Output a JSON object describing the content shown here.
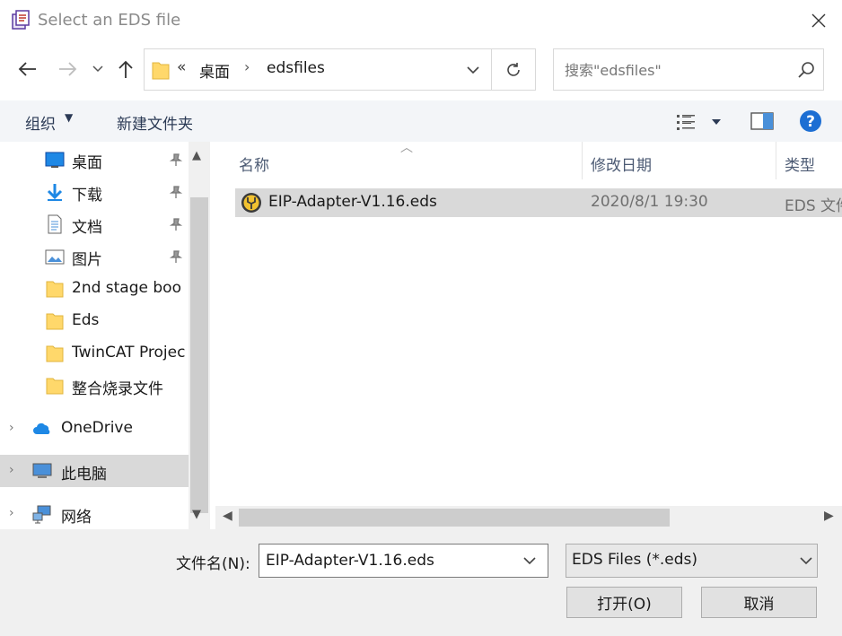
{
  "window": {
    "title": "Select an EDS file"
  },
  "address": {
    "overflow": "«",
    "crumbs": [
      "桌面",
      "edsfiles"
    ],
    "separator": "›"
  },
  "search": {
    "placeholder": "搜索\"edsfiles\""
  },
  "toolbar": {
    "organize_label": "组织",
    "new_folder_label": "新建文件夹"
  },
  "nav": {
    "quick_access": [
      {
        "label": "桌面",
        "icon": "desktop-icon",
        "pinned": true
      },
      {
        "label": "下载",
        "icon": "download-icon",
        "pinned": true
      },
      {
        "label": "文档",
        "icon": "document-icon",
        "pinned": true
      },
      {
        "label": "图片",
        "icon": "pictures-icon",
        "pinned": true
      },
      {
        "label": "2nd stage boo",
        "icon": "folder-icon",
        "pinned": false
      },
      {
        "label": "Eds",
        "icon": "folder-icon",
        "pinned": false
      },
      {
        "label": "TwinCAT Projec",
        "icon": "folder-icon",
        "pinned": false
      },
      {
        "label": "整合烧录文件",
        "icon": "folder-icon",
        "pinned": false
      }
    ],
    "onedrive": "OneDrive",
    "this_pc": "此电脑",
    "network": "网络"
  },
  "files": {
    "columns": [
      "名称",
      "修改日期",
      "类型"
    ],
    "rows": [
      {
        "name": "EIP-Adapter-V1.16.eds",
        "modified": "2020/8/1 19:30",
        "type": "EDS 文件"
      }
    ]
  },
  "footer": {
    "filename_label": "文件名(N):",
    "filename_value": "EIP-Adapter-V1.16.eds",
    "filter_value": "EDS Files (*.eds)",
    "open_label": "打开(O)",
    "cancel_label": "取消"
  },
  "colors": {
    "accent": "#0063b1",
    "folder": "#ffd86b",
    "selection": "#d9d9d9",
    "help": "#1c6ed3"
  }
}
